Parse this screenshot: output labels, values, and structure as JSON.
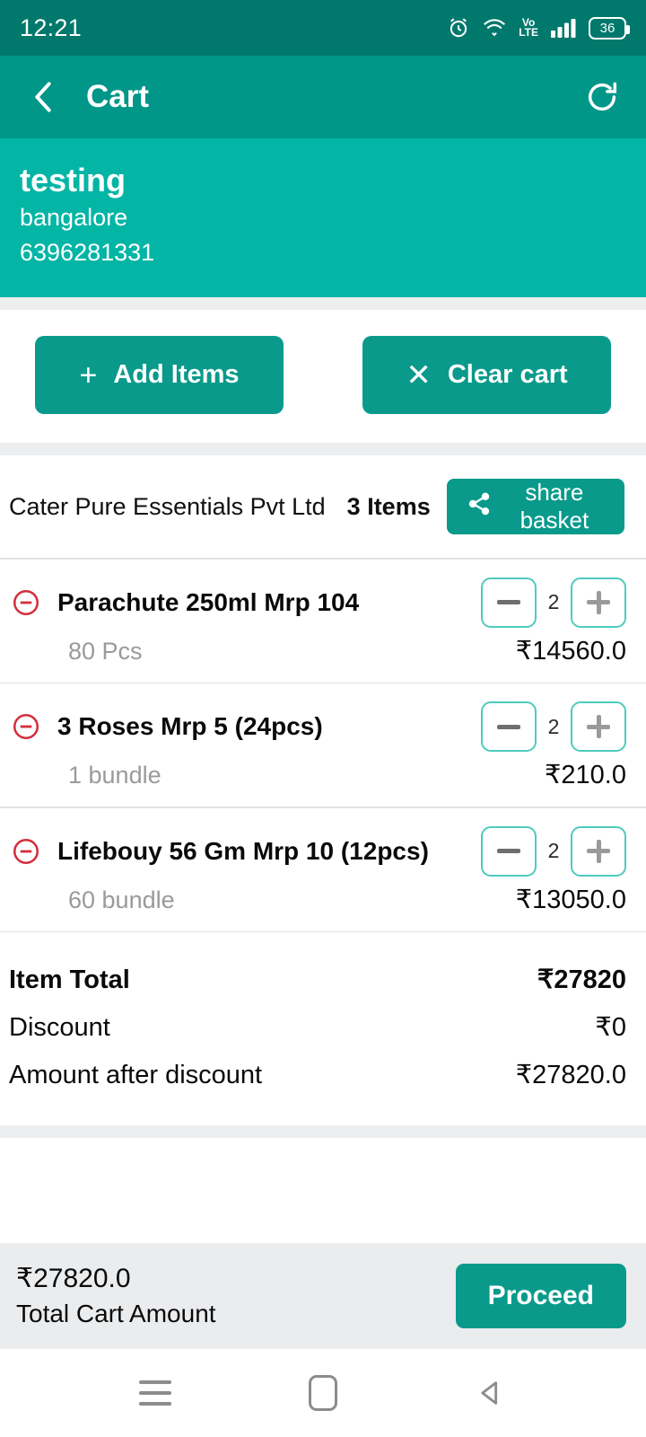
{
  "status_bar": {
    "time": "12:21",
    "battery_level": "36",
    "volte_top": "Vo",
    "volte_bottom": "LTE",
    "icons": [
      "alarm-icon",
      "wifi-icon",
      "volte-icon",
      "signal-icon",
      "battery-icon"
    ]
  },
  "app_bar": {
    "title": "Cart",
    "back_icon": "chevron-left-icon",
    "refresh_icon": "refresh-icon"
  },
  "customer": {
    "name": "testing",
    "city": "bangalore",
    "phone": "6396281331"
  },
  "actions": {
    "add_items_label": "Add Items",
    "add_items_icon": "plus-icon",
    "clear_cart_label": "Clear cart",
    "clear_cart_icon": "close-icon"
  },
  "vendor": {
    "name": "Cater Pure Essentials Pvt Ltd",
    "item_count": "3 Items",
    "share_label": "share basket",
    "share_icon": "share-icon"
  },
  "items": [
    {
      "title": "Parachute 250ml Mrp 104",
      "unit": "80 Pcs",
      "quantity": "2",
      "price": "₹14560.0"
    },
    {
      "title": "3 Roses Mrp 5 (24pcs)",
      "unit": "1 bundle",
      "quantity": "2",
      "price": "₹210.0"
    },
    {
      "title": "Lifebouy 56 Gm Mrp 10 (12pcs)",
      "unit": "60 bundle",
      "quantity": "2",
      "price": "₹13050.0"
    }
  ],
  "summary": [
    {
      "label": "Item Total",
      "value": "₹27820"
    },
    {
      "label": "Discount",
      "value": "₹0"
    },
    {
      "label": "Amount after discount",
      "value": "₹27820.0"
    }
  ],
  "bottom_bar": {
    "amount": "₹27820.0",
    "caption": "Total Cart Amount",
    "proceed_label": "Proceed"
  },
  "nav_bar": {
    "recents_icon": "menu-icon",
    "home_icon": "home-square-icon",
    "back_icon": "back-triangle-icon"
  },
  "colors": {
    "status_bar": "#00786C",
    "app_bar": "#009688",
    "customer_banner": "#03B5A5",
    "button_teal": "#099A8B",
    "stepper_border": "#4ECBBE",
    "remove_red": "#D32F3C",
    "gap_gray": "#ECEEEF",
    "bottom_bar_gray": "#EBECEE"
  }
}
